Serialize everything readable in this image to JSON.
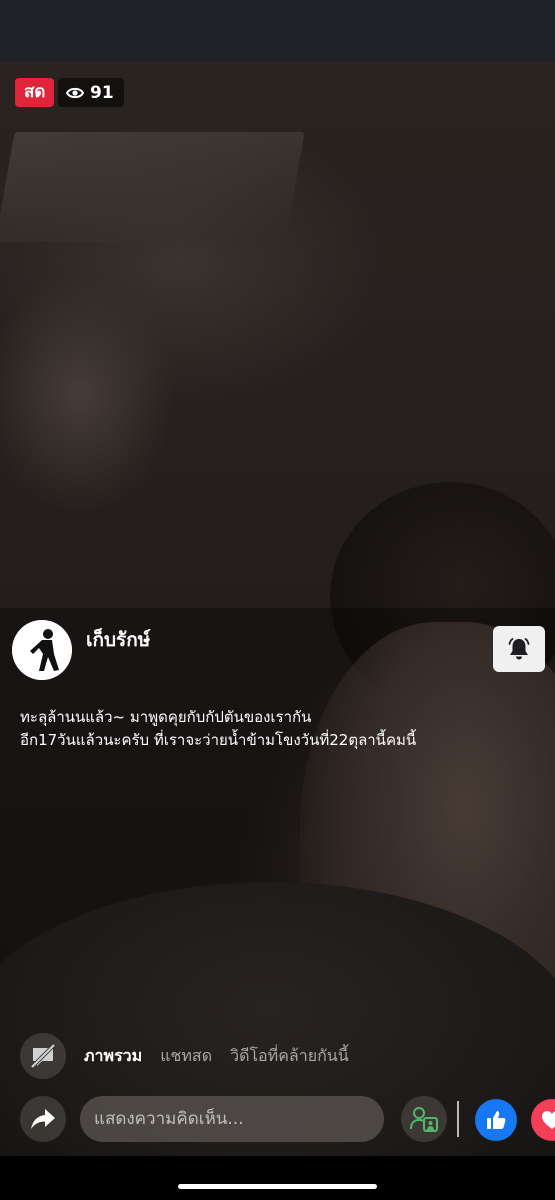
{
  "live": {
    "badge_label": "สด",
    "viewer_count": "91"
  },
  "page": {
    "name": "เก็บรักษ์",
    "avatar_text": "เก็บรักษ์"
  },
  "caption": {
    "line1": "ทะลุล้านนแล้ว~ มาพูดคุยกับกัปตันของเรากัน",
    "line2": "อีก17วันแล้วนะครับ ที่เราจะว่ายน้ำข้ามโขงวันที่22ตุลานี้คมนี้"
  },
  "tabs": [
    {
      "label": "ภาพรวม",
      "active": true
    },
    {
      "label": "แชทสด",
      "active": false
    },
    {
      "label": "วิดีโอที่คล้ายกันนี้",
      "active": false
    }
  ],
  "comment": {
    "placeholder": "แสดงความคิดเห็น..."
  },
  "icons": {
    "eye": "eye-icon",
    "bell": "bell-icon",
    "mute": "caption-off-icon",
    "share": "share-arrow-icon",
    "guest": "request-to-join-icon",
    "like": "thumbs-up-icon",
    "love": "heart-icon"
  },
  "colors": {
    "live_red": "#e0253b",
    "like_blue": "#1877f2",
    "love_red": "#f33e58"
  }
}
